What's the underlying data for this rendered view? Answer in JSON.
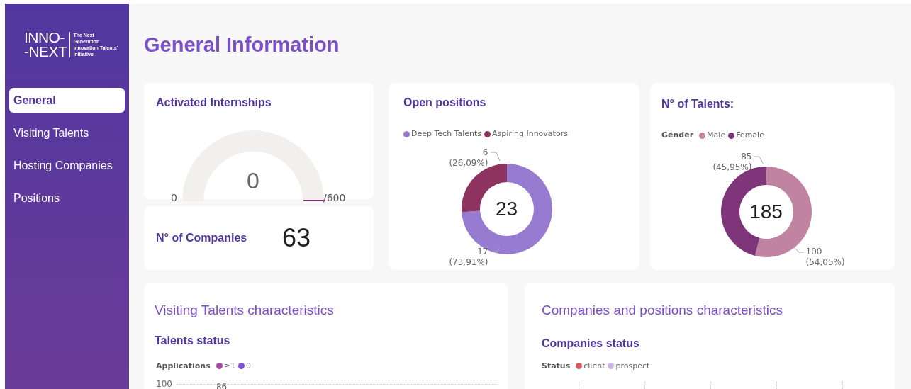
{
  "sidebar": {
    "logo": {
      "wordmark_lines": [
        "INNO-",
        "-NEXT"
      ],
      "tagline": "The Next Generation Innovation Talents' Initiative"
    },
    "items": [
      {
        "label": "General",
        "selected": true
      },
      {
        "label": "Visiting Talents",
        "selected": false
      },
      {
        "label": "Hosting Companies",
        "selected": false
      },
      {
        "label": "Positions",
        "selected": false
      }
    ]
  },
  "page_title": "General Information",
  "activated_internships": {
    "title": "Activated Internships",
    "value": "0",
    "min": "0",
    "max": "/600"
  },
  "companies": {
    "title": "N° of Companies",
    "value": "63"
  },
  "open_positions": {
    "total": "23",
    "legend": [
      {
        "color": "#977bd0"
      },
      {
        "color": "#8e3360"
      }
    ],
    "chart_data": {
      "type": "donut",
      "title": "Open positions",
      "categories": [
        "Deep Tech Talents",
        "Aspiring Innovators"
      ],
      "series": [
        {
          "values": [
            73.91,
            26.09
          ]
        }
      ],
      "value_labels": [
        "17 (73,91%)",
        "6 (26,09%)"
      ]
    }
  },
  "talents": {
    "total": "185",
    "legend": [
      {
        "color": "#c084a2"
      },
      {
        "color": "#7e3579"
      }
    ],
    "chart_data": {
      "type": "donut",
      "title": "N° of Talents:",
      "categories": [
        "Male",
        "Female"
      ],
      "series": [
        {
          "name": "Gender",
          "values": [
            54.05,
            45.95
          ]
        }
      ],
      "value_labels": [
        "100 (54,05%)",
        "85 (45,95%)"
      ]
    }
  },
  "visiting_talents": {
    "title": "Visiting Talents characteristics",
    "subtitle": "Talents status",
    "legend_title": "Applications",
    "legend": [
      {
        "label": "≥1",
        "color": "#a84ca8"
      },
      {
        "label": "0",
        "color": "#7c52cc"
      }
    ],
    "y_tick": "100",
    "bar_label": "86"
  },
  "companies_positions": {
    "title": "Companies and positions characteristics",
    "subtitle": "Companies status",
    "legend_title": "Status",
    "legend": [
      {
        "label": "client",
        "color": "#d45a63"
      },
      {
        "label": "prospect",
        "color": "#c9b6e6"
      }
    ]
  }
}
